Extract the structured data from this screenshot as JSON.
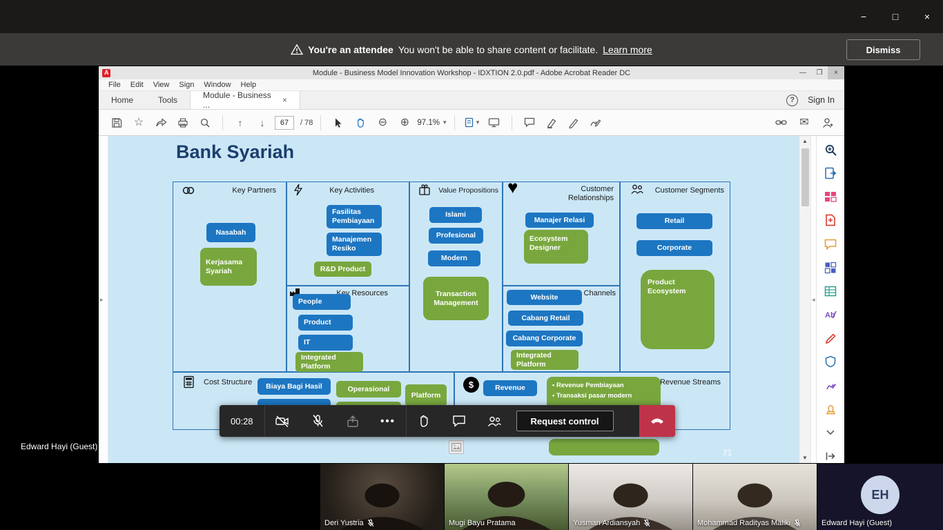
{
  "colors": {
    "chip_blue": "#1d76c2",
    "chip_green": "#79a73e",
    "canvas_border": "#2e75b6",
    "canvas_background": "#cbe7f6",
    "teams_red": "#bf3349",
    "banner_background": "#3b3a39"
  },
  "os_titlebar": {
    "minimize": "−",
    "maximize": "□",
    "close": "×"
  },
  "banner": {
    "attendee_bold": "You're an attendee",
    "message": "You won't be able to share content or facilitate.",
    "learn_more": "Learn more",
    "dismiss": "Dismiss"
  },
  "presenter_label": "Edward Hayi (Guest)",
  "acrobat": {
    "window_title": "Module - Business Model Innovation Workshop - IDXTION 2.0.pdf - Adobe Acrobat Reader DC",
    "menu": [
      "File",
      "Edit",
      "View",
      "Sign",
      "Window",
      "Help"
    ],
    "tab_home": "Home",
    "tab_tools": "Tools",
    "tab_document": "Module - Business ...",
    "tab_close": "×",
    "help": "?",
    "sign_in": "Sign In",
    "page_current": "67",
    "page_total": "/ 78",
    "zoom_level": "97.1%",
    "toolbar_icons": [
      "save-icon",
      "star-icon",
      "share-icon",
      "print-icon",
      "search-icon",
      "page-up-icon",
      "page-down-icon",
      "select-tool-icon",
      "hand-tool-icon",
      "zoom-out-icon",
      "zoom-in-icon",
      "page-view-icon",
      "presentation-icon",
      "comment-icon",
      "highlight-icon",
      "draw-icon",
      "sign-icon",
      "link-icon",
      "email-icon",
      "add-account-icon"
    ],
    "sidebar_tool_icons": [
      "zoom-tool-icon",
      "export-pdf-icon",
      "organize-pages-icon",
      "create-pdf-icon",
      "comment-tool-icon",
      "combine-files-icon",
      "spreadsheet-icon",
      "fill-sign-icon",
      "edit-pdf-icon",
      "protect-icon",
      "pen-tool-icon",
      "stamp-icon",
      "more-tools-chevron-icon",
      "open-pane-icon"
    ]
  },
  "bmc": {
    "title": "Bank Syariah",
    "page_number": "71",
    "sections": {
      "key_partners": {
        "label": "Key Partners",
        "icon": "link-rings-icon",
        "items": [
          "Nasabah",
          "Kerjasama Syariah"
        ]
      },
      "key_activities": {
        "label": "Key Activities",
        "icon": "lightning-icon",
        "items": [
          "Fasilitas Pembiayaan",
          "Manajemen Resiko",
          "R&D Product"
        ]
      },
      "key_resources": {
        "label": "Key Resources",
        "icon": "factory-icon",
        "items": [
          "People",
          "Product",
          "IT",
          "Integrated Platform"
        ]
      },
      "value_propositions": {
        "label": "Value Propositions",
        "icon": "gift-icon",
        "items": [
          "Islami",
          "Profesional",
          "Modern",
          "Transaction Management"
        ]
      },
      "customer_relationships": {
        "label": "Customer Relationships",
        "icon": "heart-icon",
        "heart": "♥",
        "items": [
          "Manajer Relasi",
          "Ecosystem Designer"
        ]
      },
      "channels": {
        "label": "Channels",
        "items": [
          "Website",
          "Cabang Retail",
          "Cabang Corporate",
          "Integrated Platform"
        ]
      },
      "customer_segments": {
        "label": "Customer Segments",
        "icon": "people-icon",
        "items": [
          "Retail",
          "Corporate",
          "Product Ecosystem"
        ]
      },
      "cost_structure": {
        "label": "Cost Structure",
        "icon": "calculator-icon",
        "items": [
          "Biaya Bagi Hasil",
          "Operasional",
          "Platform"
        ]
      },
      "revenue_streams": {
        "label": "Revenue Streams",
        "icon": "dollar-icon",
        "dollar": "$",
        "items": [
          "Revenue"
        ],
        "bullets": [
          "• Revenue Pembiayaan",
          "• Transaksi pasar modern"
        ]
      }
    }
  },
  "meeting_bar": {
    "timer": "00:28",
    "request_control": "Request control",
    "icons": [
      "camera-off-icon",
      "mic-off-icon",
      "share-screen-icon",
      "more-options-icon",
      "raise-hand-icon",
      "chat-icon",
      "participants-icon",
      "hang-up-icon"
    ]
  },
  "participants": [
    {
      "name": "Deri Yustria",
      "muted": true
    },
    {
      "name": "Mugi Bayu Pratama",
      "muted": false
    },
    {
      "name": "Yusman Ardiansyah",
      "muted": true
    },
    {
      "name": "Mohammad Radityas Maliki",
      "muted": true
    },
    {
      "name": "Edward Hayi (Guest)",
      "muted": false,
      "initials": "EH"
    }
  ]
}
